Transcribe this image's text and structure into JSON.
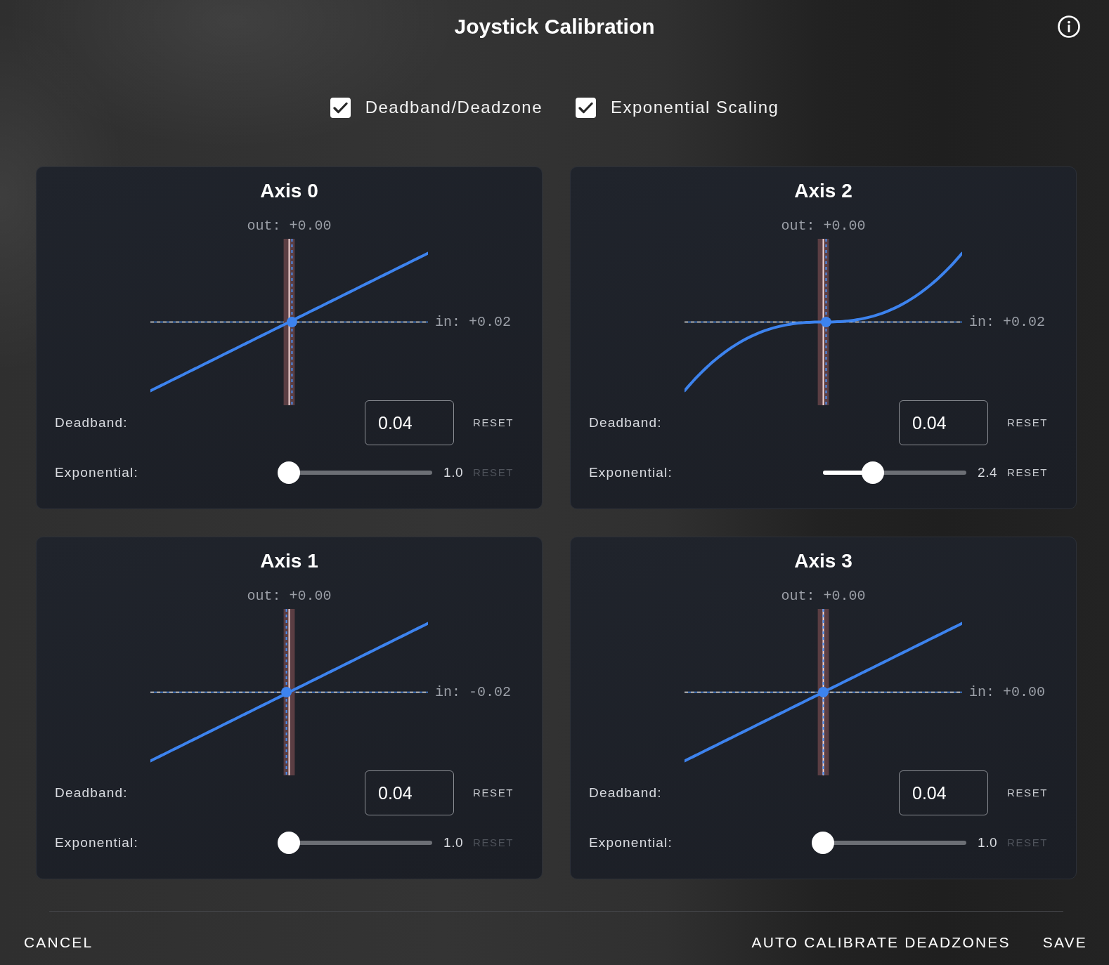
{
  "dialog": {
    "title": "Joystick Calibration"
  },
  "options": [
    {
      "label": "Deadband/Deadzone",
      "checked": true
    },
    {
      "label": "Exponential Scaling",
      "checked": true
    }
  ],
  "axes": [
    {
      "title": "Axis 0",
      "output_reading": "out: +0.00",
      "input_reading": "in: +0.02",
      "deadband": {
        "label": "Deadband:",
        "value": "0.04",
        "reset": {
          "label": "RESET",
          "disabled": false
        }
      },
      "exponential": {
        "label": "Exponential:",
        "level": 0,
        "reading": "1.0",
        "reset": {
          "label": "RESET",
          "disabled": true
        }
      }
    },
    {
      "title": "Axis 2",
      "output_reading": "out: +0.00",
      "input_reading": "in: +0.02",
      "deadband": {
        "label": "Deadband:",
        "value": "0.04",
        "reset": {
          "label": "RESET",
          "disabled": false
        }
      },
      "exponential": {
        "label": "Exponential:",
        "level": 0.35,
        "reading": "2.4",
        "reset": {
          "label": "RESET",
          "disabled": false
        }
      }
    },
    {
      "title": "Axis 1",
      "output_reading": "out: +0.00",
      "input_reading": "in: -0.02",
      "deadband": {
        "label": "Deadband:",
        "value": "0.04",
        "reset": {
          "label": "RESET",
          "disabled": false
        }
      },
      "exponential": {
        "label": "Exponential:",
        "level": 0,
        "reading": "1.0",
        "reset": {
          "label": "RESET",
          "disabled": true
        }
      }
    },
    {
      "title": "Axis 3",
      "output_reading": "out: +0.00",
      "input_reading": "in: +0.00",
      "deadband": {
        "label": "Deadband:",
        "value": "0.04",
        "reset": {
          "label": "RESET",
          "disabled": false
        }
      },
      "exponential": {
        "label": "Exponential:",
        "level": 0,
        "reading": "1.0",
        "reset": {
          "label": "RESET",
          "disabled": true
        }
      }
    }
  ],
  "footer": {
    "cancel": "CANCEL",
    "actions": [
      "AUTO CALIBRATE DEADZONES",
      "SAVE"
    ]
  }
}
